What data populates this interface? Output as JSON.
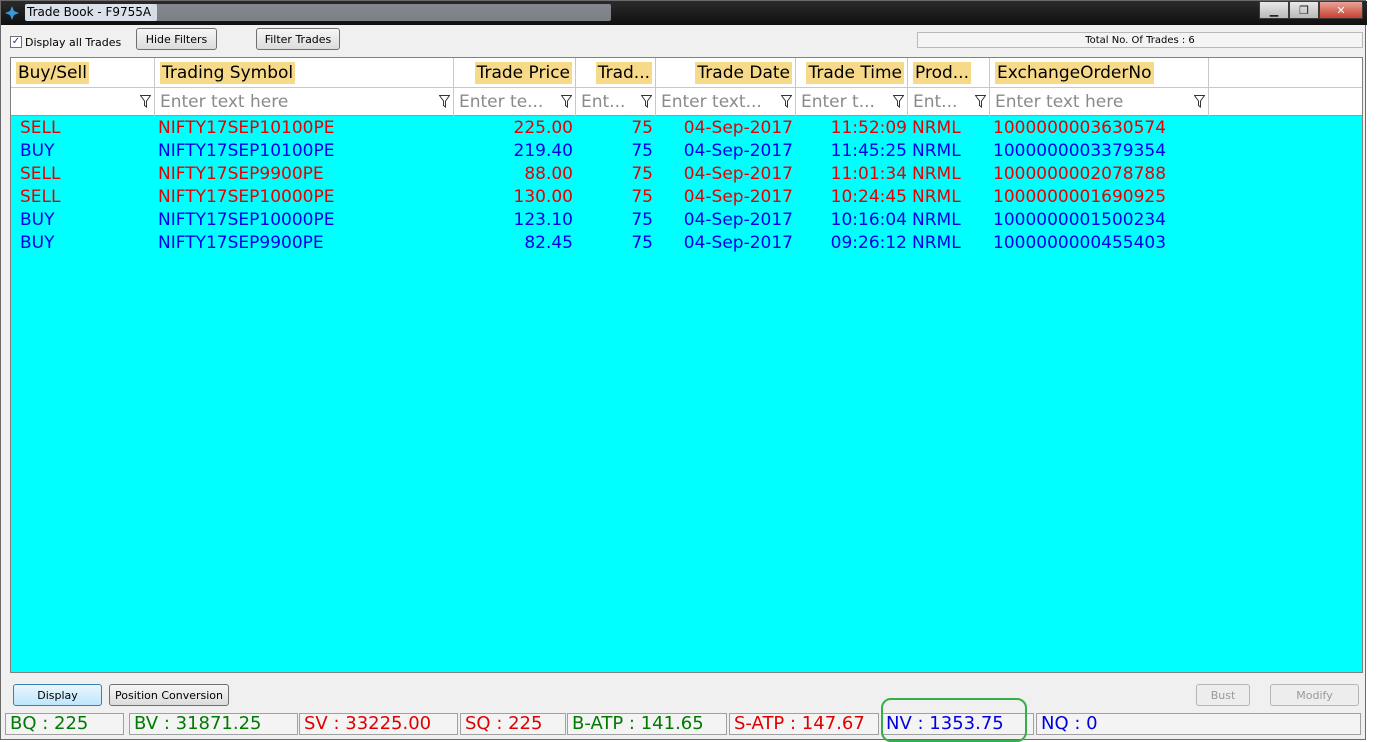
{
  "window": {
    "title": "Trade Book - F9755A",
    "minimize": "▁",
    "maximize": "❐",
    "close": "✕"
  },
  "toolbar": {
    "display_all_checked": "✓",
    "display_all_label": "Display all Trades",
    "hide_filters": "Hide Filters",
    "filter_trades": "Filter Trades",
    "total_trades": "Total No. Of Trades : 6"
  },
  "columns": [
    "Buy/Sell",
    "Trading Symbol",
    "Trade Price",
    "Trad...",
    "Trade Date",
    "Trade Time",
    "Prod...",
    "ExchangeOrderNo"
  ],
  "filters": [
    "",
    "Enter text here",
    "Enter te...",
    "Ent...",
    "Enter text...",
    "Enter t...",
    "Ent...",
    "Enter text here"
  ],
  "trades": [
    {
      "side": "SELL",
      "symbol": "NIFTY17SEP10100PE",
      "price": "225.00",
      "qty": "75",
      "date": "04-Sep-2017",
      "time": "11:52:09",
      "product": "NRML",
      "order_no": "1000000003630574"
    },
    {
      "side": "BUY",
      "symbol": "NIFTY17SEP10100PE",
      "price": "219.40",
      "qty": "75",
      "date": "04-Sep-2017",
      "time": "11:45:25",
      "product": "NRML",
      "order_no": "1000000003379354"
    },
    {
      "side": "SELL",
      "symbol": "NIFTY17SEP9900PE",
      "price": "88.00",
      "qty": "75",
      "date": "04-Sep-2017",
      "time": "11:01:34",
      "product": "NRML",
      "order_no": "1000000002078788"
    },
    {
      "side": "SELL",
      "symbol": "NIFTY17SEP10000PE",
      "price": "130.00",
      "qty": "75",
      "date": "04-Sep-2017",
      "time": "10:24:45",
      "product": "NRML",
      "order_no": "1000000001690925"
    },
    {
      "side": "BUY",
      "symbol": "NIFTY17SEP10000PE",
      "price": "123.10",
      "qty": "75",
      "date": "04-Sep-2017",
      "time": "10:16:04",
      "product": "NRML",
      "order_no": "1000000001500234"
    },
    {
      "side": "BUY",
      "symbol": "NIFTY17SEP9900PE",
      "price": "82.45",
      "qty": "75",
      "date": "04-Sep-2017",
      "time": "09:26:12",
      "product": "NRML",
      "order_no": "1000000000455403"
    }
  ],
  "bottom": {
    "display": "Display",
    "position_conversion": "Position Conversion",
    "bust": "Bust",
    "modify": "Modify"
  },
  "status": {
    "bq": "BQ : 225",
    "bv": "BV : 31871.25",
    "sv": "SV : 33225.00",
    "sq": "SQ : 225",
    "batp": "B-ATP : 141.65",
    "satp": "S-ATP : 147.67",
    "nv": "NV : 1353.75",
    "nq": "NQ : 0"
  },
  "colors": {
    "sell": "#e60000",
    "buy": "#0000e6",
    "grid_bg": "#00ffff",
    "header_highlight": "#f7d98a",
    "status_green": "#007a00",
    "status_red": "#e00000",
    "status_blue": "#0000e0",
    "callout": "#33b04a"
  }
}
